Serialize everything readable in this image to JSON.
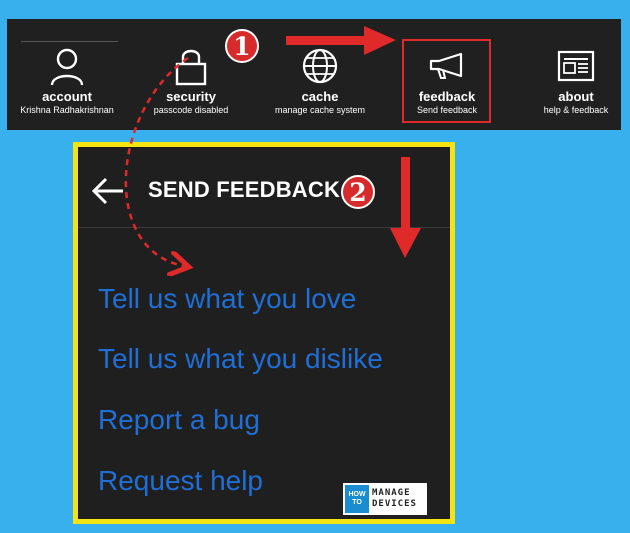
{
  "toolbar": {
    "items": [
      {
        "title": "account",
        "subtitle": "Krishna Radhakrishnan",
        "icon": "person-icon"
      },
      {
        "title": "security",
        "subtitle": "passcode disabled",
        "icon": "lock-icon"
      },
      {
        "title": "cache",
        "subtitle": "manage cache system",
        "icon": "globe-icon"
      },
      {
        "title": "feedback",
        "subtitle": "Send feedback",
        "icon": "megaphone-icon"
      },
      {
        "title": "about",
        "subtitle": "help & feedback",
        "icon": "newspaper-icon"
      }
    ]
  },
  "annotations": {
    "step1": "1",
    "step2": "2",
    "highlight_color": "#e02a2a",
    "panel_border_color": "#f4e512"
  },
  "panel": {
    "title": "SEND FEEDBACK",
    "items": [
      "Tell us what you love",
      "Tell us what you dislike",
      "Report a bug",
      "Request help"
    ]
  },
  "logo": {
    "how": "HOW",
    "to": "TO",
    "manage": "MANAGE",
    "devices": "DEVICES"
  },
  "colors": {
    "background": "#38b0ee",
    "toolbar": "#202020",
    "link": "#1f6fd6"
  }
}
